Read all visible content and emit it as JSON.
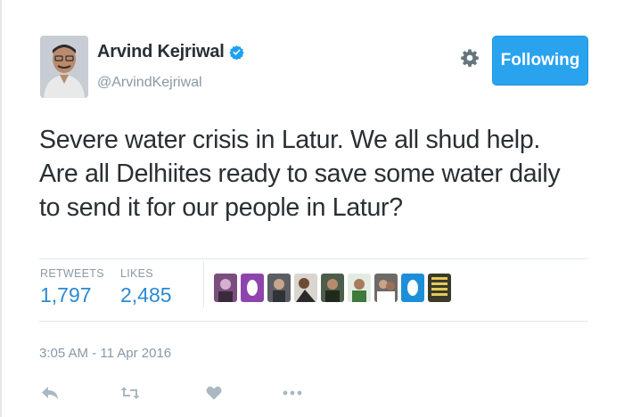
{
  "author": {
    "display_name": "Arvind Kejriwal",
    "handle": "@ArvindKejriwal",
    "verified": true
  },
  "follow_button": {
    "label": "Following"
  },
  "tweet": {
    "lines": [
      "Severe water crisis in Latur. We all shud help.",
      "Are all Delhiites ready to save some water daily",
      "to send it for our people in Latur?"
    ]
  },
  "stats": {
    "retweets_label": "RETWEETS",
    "retweets_count": "1,797",
    "likes_label": "LIKES",
    "likes_count": "2,485"
  },
  "likers_count_shown": 9,
  "timestamp": "3:05 AM - 11 Apr 2016",
  "actions": [
    "reply-icon",
    "retweet-icon",
    "like-icon",
    "more-icon"
  ],
  "colors": {
    "follow_button": "#2aa3ef",
    "stat_value": "#2a8ad2",
    "muted": "#8899a6",
    "text": "#292f33",
    "verified": "#1da1f2"
  }
}
